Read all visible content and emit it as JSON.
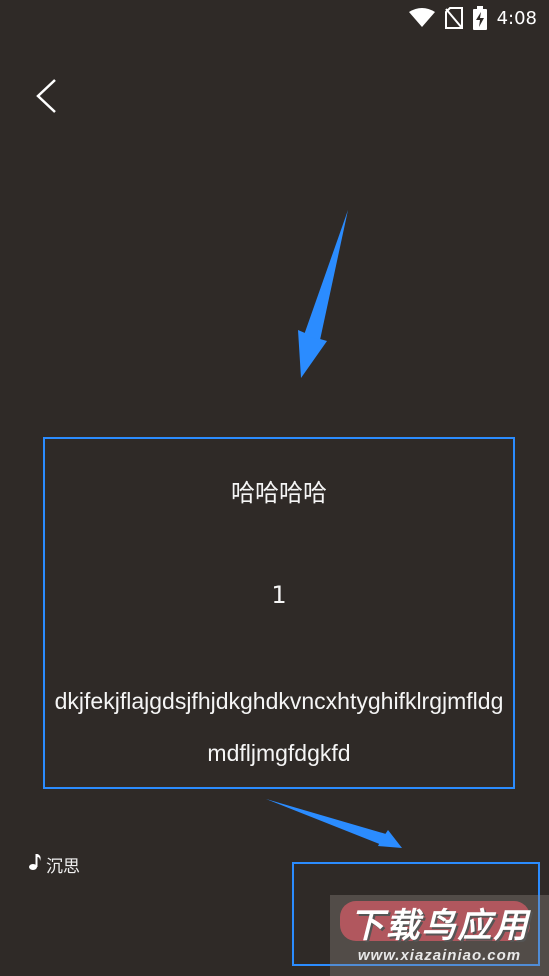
{
  "status_bar": {
    "time": "4:08",
    "icons": [
      "wifi-icon",
      "no-sim-icon",
      "battery-charging-icon"
    ]
  },
  "nav": {
    "back_icon": "chevron-left-icon"
  },
  "card": {
    "title": "哈哈哈哈",
    "number": "1",
    "body": "dkjfekjflajgdsjfhjdkghdkvncxhtyghifklrgjmfldgmdfljmgfdgkfd"
  },
  "music": {
    "icon": "music-note-icon",
    "label": "沉思"
  },
  "watermark": {
    "title": "下载鸟应用",
    "url": "www.xiazainiao.com"
  },
  "colors": {
    "background": "#2f2a27",
    "annotation": "#2b8cff",
    "text": "#f5f5f5"
  }
}
